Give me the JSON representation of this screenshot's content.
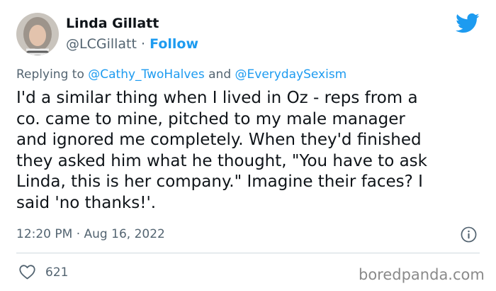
{
  "author": {
    "name": "Linda Gillatt",
    "handle": "@LCGillatt",
    "separator": "·",
    "follow_label": "Follow"
  },
  "reply": {
    "prefix": "Replying to",
    "mention1": "@Cathy_TwoHalves",
    "conjunction": "and",
    "mention2": "@EverydaySexism"
  },
  "tweet": {
    "lines": [
      "I'd a similar thing when I lived in Oz - reps from a",
      "co. came to mine, pitched to my male manager",
      "and ignored me completely. When they'd finished",
      "they asked him what he thought, \"You have to ask",
      "Linda, this is her company.\" Imagine their faces? I",
      "said 'no thanks!'."
    ]
  },
  "meta": {
    "timestamp": "12:20 PM · Aug 16, 2022"
  },
  "actions": {
    "like_count": "621"
  },
  "watermark": "boredpanda.com",
  "icons": {
    "brand": "twitter-bird-icon",
    "info": "info-icon",
    "like": "heart-icon"
  },
  "colors": {
    "accent": "#1d9bf0",
    "secondary_text": "#536471",
    "primary_text": "#0f1419",
    "divider": "#cfd9de"
  }
}
